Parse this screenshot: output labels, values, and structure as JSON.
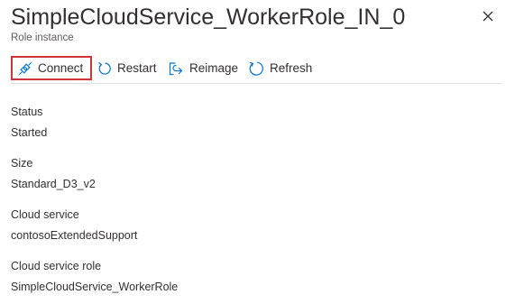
{
  "header": {
    "title": "SimpleCloudService_WorkerRole_IN_0",
    "subtitle": "Role instance"
  },
  "toolbar": {
    "connect_label": "Connect",
    "restart_label": "Restart",
    "reimage_label": "Reimage",
    "refresh_label": "Refresh"
  },
  "properties": {
    "status_label": "Status",
    "status_value": "Started",
    "size_label": "Size",
    "size_value": "Standard_D3_v2",
    "cloud_service_label": "Cloud service",
    "cloud_service_value": "contosoExtendedSupport",
    "cloud_service_role_label": "Cloud service role",
    "cloud_service_role_value": "SimpleCloudService_WorkerRole"
  },
  "colors": {
    "accent": "#0078d4",
    "highlight_border": "#d13438",
    "text": "#323130",
    "divider": "#e1dfdd"
  },
  "icons": {
    "connect": "plug-connect-icon",
    "restart": "restart-icon",
    "reimage": "reimage-icon",
    "refresh": "refresh-icon",
    "close": "close-icon"
  }
}
